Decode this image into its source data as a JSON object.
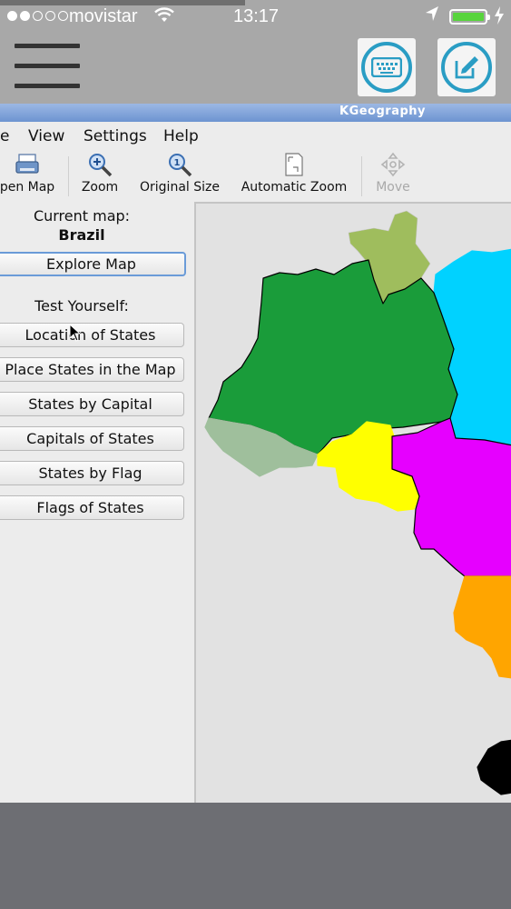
{
  "status_bar": {
    "carrier": "movistar",
    "time": "13:17",
    "battery_color": "#58d43d"
  },
  "app_header": {
    "menu_icon": "hamburger-menu-icon",
    "keyboard_icon": "keyboard-icon",
    "edit_icon": "edit-icon",
    "accent_color": "#2a9dc4"
  },
  "window": {
    "title": "KGeography"
  },
  "menu": {
    "items": [
      "e",
      "View",
      "Settings",
      "Help"
    ]
  },
  "toolbar": {
    "open_map": "pen Map",
    "zoom": "Zoom",
    "original_size": "Original Size",
    "automatic_zoom": "Automatic Zoom",
    "move": "Move"
  },
  "panel": {
    "current_map_label": "Current map:",
    "current_map_value": "Brazil",
    "explore_button": "Explore Map",
    "test_label": "Test Yourself:",
    "tests": [
      "Location of States",
      "Place States in the Map",
      "States by Capital",
      "Capitals of States",
      "States by Flag",
      "Flags of States"
    ]
  },
  "map": {
    "background": "#e2e2e2",
    "region_colors": [
      "#1a9c3a",
      "#9fbd5d",
      "#00d2ff",
      "#9fbf9c",
      "#ffff00",
      "#e600ff",
      "#ffa500",
      "#000000"
    ]
  }
}
